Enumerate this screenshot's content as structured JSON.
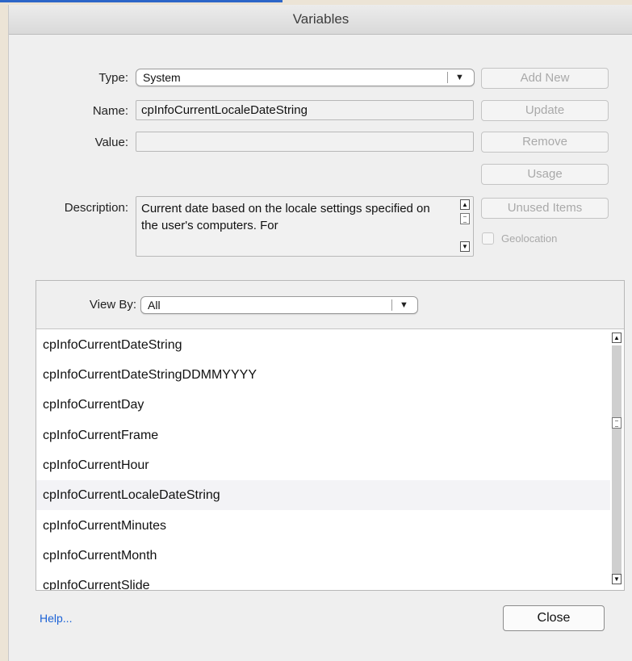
{
  "window": {
    "title": "Variables"
  },
  "form": {
    "type_label": "Type:",
    "type_value": "System",
    "name_label": "Name:",
    "name_value": "cpInfoCurrentLocaleDateString",
    "value_label": "Value:",
    "value_value": "",
    "description_label": "Description:",
    "description_text": "Current date based on the locale settings specified on the user's computers. For"
  },
  "buttons": {
    "add_new": "Add New",
    "update": "Update",
    "remove": "Remove",
    "usage": "Usage",
    "unused_items": "Unused Items",
    "close": "Close"
  },
  "geolocation": {
    "label": "Geolocation",
    "checked": false
  },
  "view_by": {
    "label": "View By:",
    "value": "All"
  },
  "variables_list": {
    "items": [
      "cpInfoCurrentDateString",
      "cpInfoCurrentDateStringDDMMYYYY",
      "cpInfoCurrentDay",
      "cpInfoCurrentFrame",
      "cpInfoCurrentHour",
      "cpInfoCurrentLocaleDateString",
      "cpInfoCurrentMinutes",
      "cpInfoCurrentMonth",
      "cpInfoCurrentSlide"
    ],
    "selected": "cpInfoCurrentLocaleDateString"
  },
  "footer": {
    "help_link": "Help..."
  },
  "colors": {
    "link": "#1b62d6",
    "disabled_text": "#a9a9a9"
  }
}
